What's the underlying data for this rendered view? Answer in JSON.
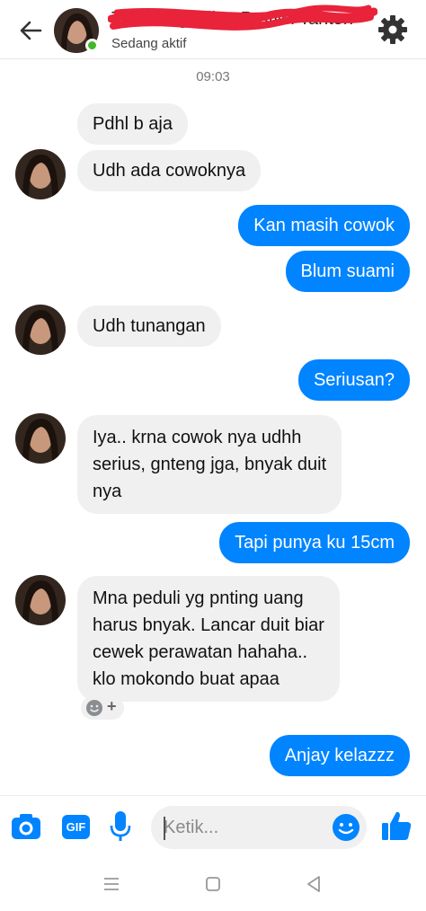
{
  "header": {
    "contact_name": "Tiara Anggelina Pratiwi Tanton",
    "status": "Sedang aktif"
  },
  "timestamp": "09:03",
  "messages": [
    {
      "from": "them",
      "text": "Pdhl b aja"
    },
    {
      "from": "them",
      "text": "Udh ada cowoknya"
    },
    {
      "from": "me",
      "text": "Kan masih cowok"
    },
    {
      "from": "me",
      "text": "Blum suami"
    },
    {
      "from": "them",
      "text": "Udh tunangan"
    },
    {
      "from": "me",
      "text": "Seriusan?"
    },
    {
      "from": "them",
      "lines": [
        "Iya.. krna cowok nya udhh",
        "serius, gnteng jga, bnyak duit",
        "nya"
      ]
    },
    {
      "from": "me",
      "text": "Tapi punya ku 15cm"
    },
    {
      "from": "them",
      "lines": [
        "Mna peduli yg pnting uang",
        "harus bnyak. Lancar duit biar",
        "cewek perawatan hahaha..",
        "klo mokondo buat apaa"
      ]
    },
    {
      "from": "me",
      "text": "Anjay kelazzz"
    }
  ],
  "composer": {
    "placeholder": "Ketik...",
    "icons": [
      "camera-icon",
      "gif-icon",
      "microphone-icon",
      "emoji-icon",
      "thumbs-up-icon"
    ],
    "gif_label": "GIF"
  },
  "reaction_button": {
    "icon": "add-reaction-icon",
    "plus": "+"
  },
  "nav": {
    "icons": [
      "recent-apps-icon",
      "home-icon",
      "back-nav-icon"
    ]
  },
  "colors": {
    "accent": "#0084ff",
    "incoming_bubble": "#f0f0f0",
    "online": "#42b72a"
  }
}
